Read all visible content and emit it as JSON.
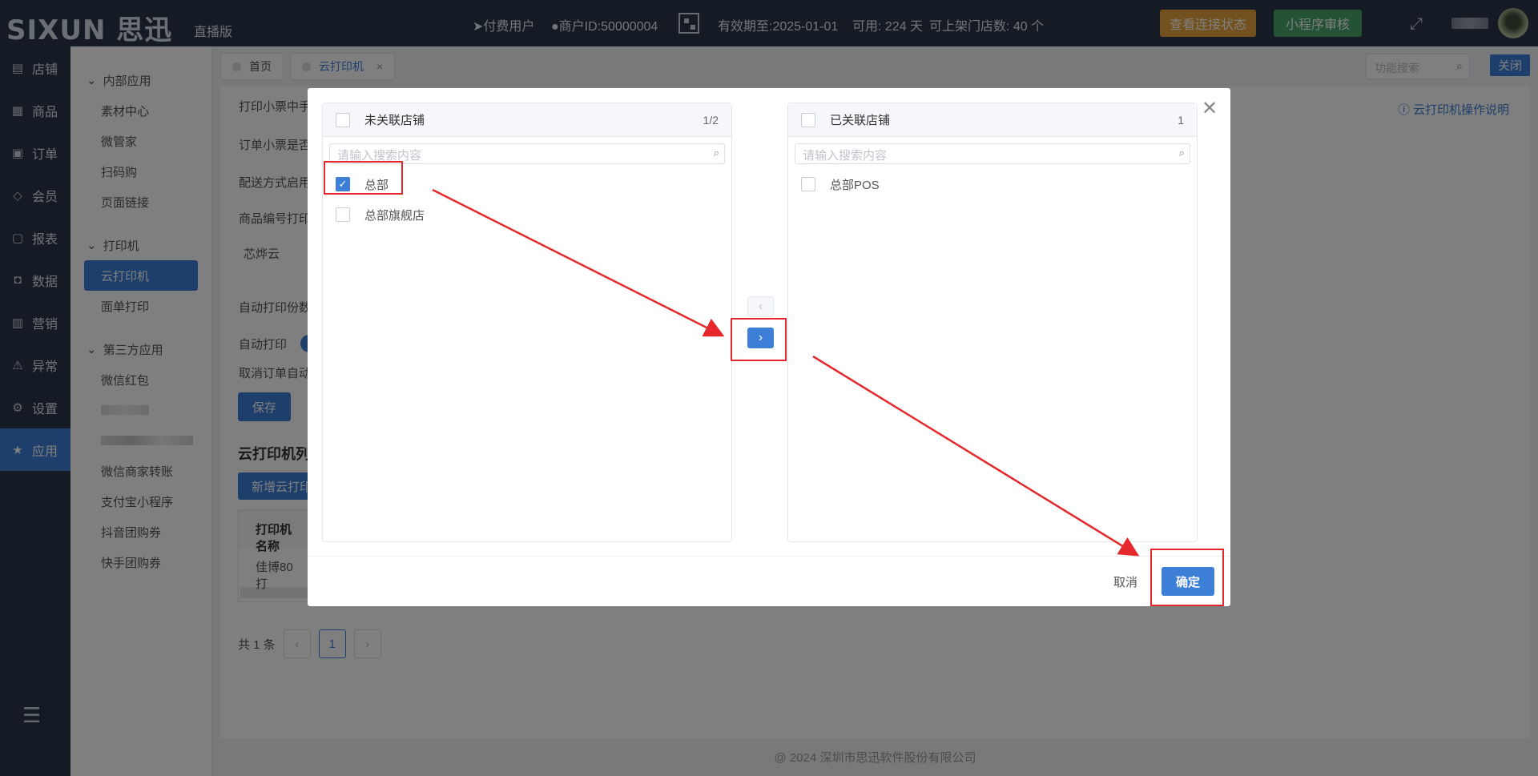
{
  "header": {
    "logo": "SIXUN 思迅",
    "edition": "直播版",
    "paid_user": "付费用户",
    "merchant_id": "商户ID:50000004",
    "valid_until": "有效期至:2025-01-01",
    "available": "可用: 224 天",
    "store_limit": "可上架门店数: 40 个",
    "btn_status": "查看连接状态",
    "btn_review": "小程序审核"
  },
  "rail": {
    "items": [
      {
        "label": "店铺",
        "icon": "shop-icon"
      },
      {
        "label": "商品",
        "icon": "gift-icon"
      },
      {
        "label": "订单",
        "icon": "order-icon"
      },
      {
        "label": "会员",
        "icon": "diamond-icon"
      },
      {
        "label": "报表",
        "icon": "bag-icon"
      },
      {
        "label": "数据",
        "icon": "lock-icon"
      },
      {
        "label": "营销",
        "icon": "bar-chart-icon"
      },
      {
        "label": "异常",
        "icon": "warning-icon"
      },
      {
        "label": "设置",
        "icon": "gear-icon"
      },
      {
        "label": "应用",
        "icon": "star-icon"
      }
    ],
    "active_index": 9
  },
  "submenu": {
    "group1": "内部应用",
    "group1_items": [
      "素材中心",
      "微管家",
      "扫码购",
      "页面链接"
    ],
    "group2": "打印机",
    "group2_items": [
      "云打印机",
      "面单打印"
    ],
    "group3": "第三方应用",
    "group3_items": [
      "微信红包",
      "微信商家转账",
      "支付宝小程序",
      "抖音团购券",
      "快手团购券"
    ]
  },
  "tabs": {
    "home": "首页",
    "cloud_printer": "云打印机"
  },
  "search": {
    "placeholder": "功能搜索"
  },
  "close_label": "关闭",
  "help_link": "云打印机操作说明",
  "form": {
    "row1": "打印小票中手",
    "row2": "订单小票是否",
    "row3": "配送方式启用",
    "row4": "商品编号打印",
    "tab_label": "芯烨云",
    "copies": "自动打印份数",
    "auto_print": "自动打印",
    "cancel_auto": "取消订单自动",
    "save": "保存"
  },
  "list": {
    "title": "云打印机列",
    "add": "新增云打印",
    "col_name": "打印机名称",
    "row1_name": "佳博80打"
  },
  "pager": {
    "total": "共 1 条",
    "current": "1"
  },
  "footer": "@ 2024 深圳市思迅软件股份有限公司",
  "dialog": {
    "left_title": "未关联店铺",
    "left_count": "1/2",
    "left_search": "请输入搜索内容",
    "left_items": [
      {
        "label": "总部",
        "checked": true
      },
      {
        "label": "总部旗舰店",
        "checked": false
      }
    ],
    "right_title": "已关联店铺",
    "right_count": "1",
    "right_search": "请输入搜索内容",
    "right_items": [
      {
        "label": "总部POS",
        "checked": false
      }
    ],
    "cancel": "取消",
    "confirm": "确定"
  },
  "colors": {
    "accent": "#3d7fd6",
    "header": "#29374a",
    "annotation": "#e5282b",
    "warning": "#e6a23c",
    "success": "#47a468"
  }
}
